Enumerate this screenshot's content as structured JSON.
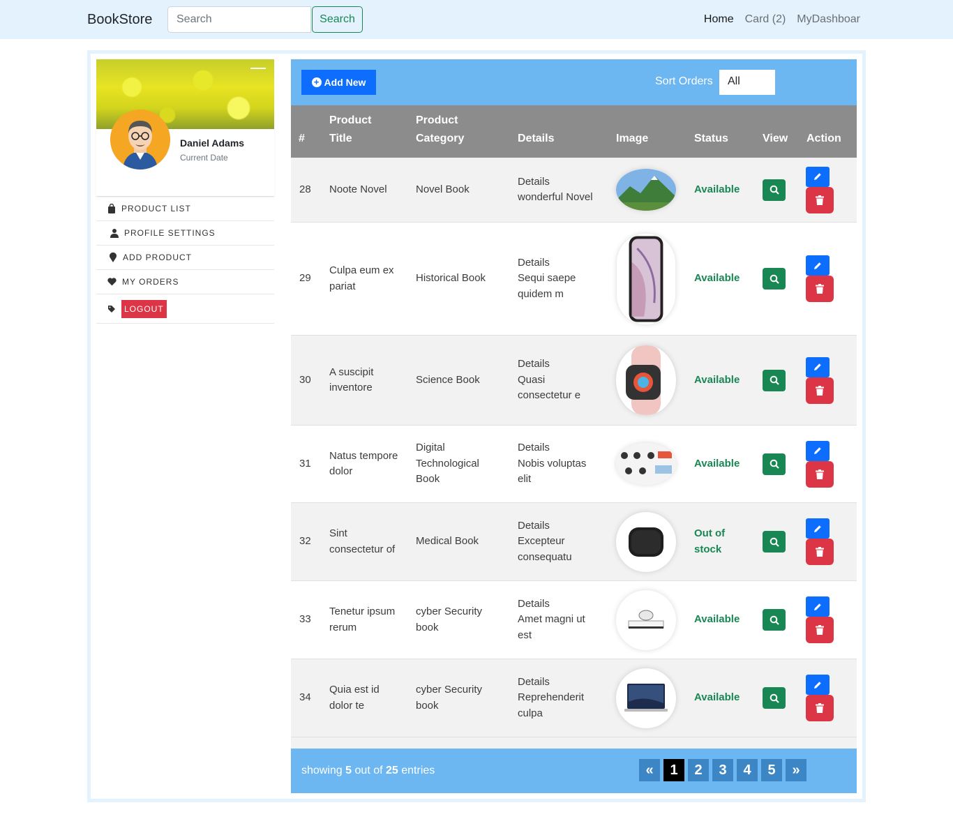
{
  "navbar": {
    "brand": "BookStore",
    "search_placeholder": "Search",
    "search_button": "Search",
    "links": [
      "Home",
      "Card (2)",
      "MyDashboar"
    ]
  },
  "sidebar": {
    "user_name": "Daniel Adams",
    "user_subtitle": "Current Date",
    "menu": [
      {
        "label": "PRODUCT LIST",
        "icon": "shopping-bag-icon"
      },
      {
        "label": "PROFILE SETTINGS",
        "icon": "user-icon"
      },
      {
        "label": "ADD PRODUCT",
        "icon": "map-pin-icon"
      },
      {
        "label": "MY ORDERS",
        "icon": "heart-icon"
      },
      {
        "label": "LOGOUT",
        "icon": "tag-icon"
      }
    ]
  },
  "toolbar": {
    "add_button": "Add New",
    "sort_label": "Sort Orders",
    "sort_value": "All"
  },
  "table": {
    "headers": {
      "id": "#",
      "title_line1": "Product",
      "title_line2": "Title",
      "category_line1": "Product",
      "category_line2": "Category",
      "details": "Details",
      "image": "Image",
      "status": "Status",
      "view": "View",
      "action": "Action"
    },
    "rows": [
      {
        "id": "28",
        "title": [
          "Noote Novel"
        ],
        "category": [
          "Novel Book"
        ],
        "details": [
          "Details",
          "wonderful Novel"
        ],
        "image": "mountain-landscape-image",
        "status": [
          "Available"
        ]
      },
      {
        "id": "29",
        "title": [
          "Culpa eum ex",
          "pariat"
        ],
        "category": [
          "Historical Book"
        ],
        "details": [
          "Details",
          "Sequi saepe",
          "quidem m"
        ],
        "image": "smartphone-image",
        "status": [
          "Available"
        ]
      },
      {
        "id": "30",
        "title": [
          "A suscipit",
          "inventore"
        ],
        "category": [
          "Science Book"
        ],
        "details": [
          "Details",
          "Quasi",
          "consectetur e"
        ],
        "image": "smartwatch-image",
        "status": [
          "Available"
        ]
      },
      {
        "id": "31",
        "title": [
          "Natus tempore",
          "dolor"
        ],
        "category": [
          "Digital",
          "Technological",
          "Book"
        ],
        "details": [
          "Details",
          "Nobis voluptas",
          "elit"
        ],
        "image": "headphones-image",
        "status": [
          "Available"
        ]
      },
      {
        "id": "32",
        "title": [
          "Sint",
          "consectetur of"
        ],
        "category": [
          "Medical Book"
        ],
        "details": [
          "Details",
          "Excepteur",
          "consequatu"
        ],
        "image": "speaker-image",
        "status": [
          "Out of",
          "stock"
        ]
      },
      {
        "id": "33",
        "title": [
          "Tenetur ipsum",
          "rerum"
        ],
        "category": [
          "cyber Security",
          "book"
        ],
        "details": [
          "Details",
          "Amet magni ut",
          "est"
        ],
        "image": "game-console-image",
        "status": [
          "Available"
        ]
      },
      {
        "id": "34",
        "title": [
          "Quia est id",
          "dolor te"
        ],
        "category": [
          "cyber Security",
          "book"
        ],
        "details": [
          "Details",
          "Reprehenderit",
          "culpa"
        ],
        "image": "laptop-image",
        "status": [
          "Available"
        ]
      }
    ]
  },
  "footer": {
    "showing_prefix": "showing",
    "showing_count": "5",
    "showing_middle": "out of",
    "showing_total": "25",
    "showing_suffix": "entries",
    "pages": [
      "«",
      "1",
      "2",
      "3",
      "4",
      "5",
      "»"
    ],
    "active_page": "1"
  },
  "colors": {
    "navbar_bg": "#e3f2fd",
    "toolbar_bg": "#6cb6f2",
    "header_bg": "#8c8c8c",
    "available": "#198754",
    "primary": "#0d6efd",
    "danger": "#dc3545"
  }
}
